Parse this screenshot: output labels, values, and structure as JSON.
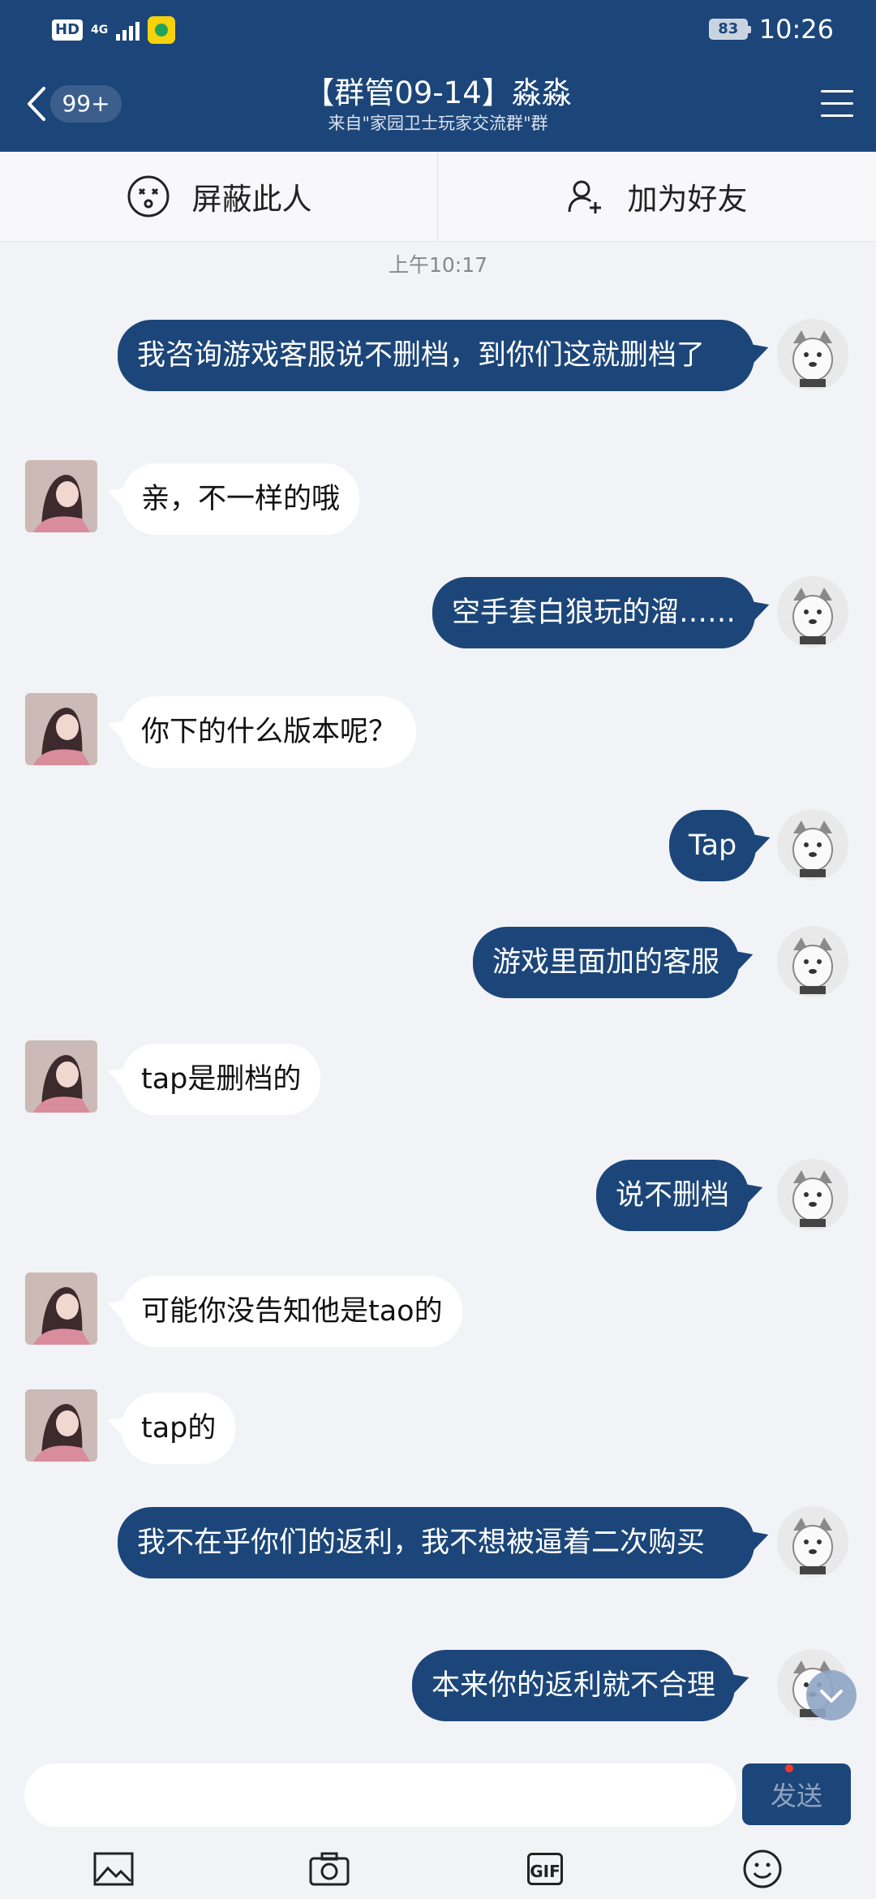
{
  "status_bar": {
    "hd": "HD",
    "network": "4G",
    "battery": "83",
    "time": "10:26"
  },
  "header": {
    "unread_count": "99+",
    "title": "【群管09-14】淼淼",
    "subtitle": "来自\"家园卫士玩家交流群\"群"
  },
  "actions": {
    "block": "屏蔽此人",
    "add_friend": "加为好友"
  },
  "chat": {
    "timestamp": "上午10:17",
    "messages": [
      {
        "from": "me",
        "text": "我咨询游戏客服说不删档，到你们这就删档了"
      },
      {
        "from": "them",
        "text": "亲，不一样的哦"
      },
      {
        "from": "me",
        "text": "空手套白狼玩的溜……"
      },
      {
        "from": "them",
        "text": "你下的什么版本呢？"
      },
      {
        "from": "me",
        "text": "Tap"
      },
      {
        "from": "me",
        "text": "游戏里面加的客服"
      },
      {
        "from": "them",
        "text": "tap是删档的"
      },
      {
        "from": "me",
        "text": "说不删档"
      },
      {
        "from": "them",
        "text": "可能你没告知他是tao的"
      },
      {
        "from": "them",
        "text": "tap的"
      },
      {
        "from": "me",
        "text": "我不在乎你们的返利，我不想被逼着二次购买"
      },
      {
        "from": "me",
        "text": "本来你的返利就不合理"
      }
    ]
  },
  "input": {
    "placeholder": "",
    "send_label": "发送"
  },
  "toolbar": {
    "gif_label": "GIF"
  },
  "colors": {
    "brand": "#1c4679",
    "background": "#f2f3f7",
    "notification_dot": "#ee3b2e"
  }
}
